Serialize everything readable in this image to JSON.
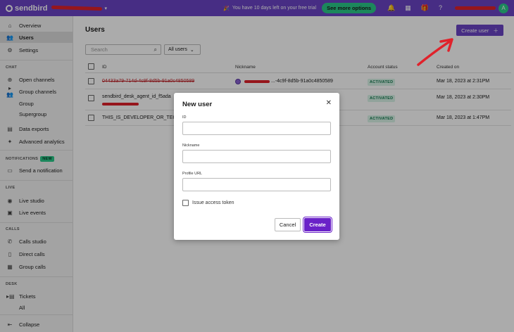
{
  "topbar": {
    "brand": "sendbird",
    "trial_text": "You have 10 days left on your free trial",
    "see_more": "See more options",
    "avatar_initial": "A",
    "icons": [
      "party-icon",
      "bell-icon",
      "grid-icon",
      "gift-icon",
      "help-icon"
    ]
  },
  "sidebar": {
    "items": [
      {
        "label": "Overview",
        "icon": "home-icon"
      },
      {
        "label": "Users",
        "icon": "users-icon"
      },
      {
        "label": "Settings",
        "icon": "gear-icon"
      }
    ],
    "chat_section": "CHAT",
    "chat_items": [
      {
        "label": "Open channels",
        "icon": "open-channels-icon"
      },
      {
        "label": "Group channels",
        "icon": "group-channels-icon"
      }
    ],
    "group_sub": [
      "Group",
      "Supergroup"
    ],
    "data_items": [
      {
        "label": "Data exports",
        "icon": "data-exports-icon"
      },
      {
        "label": "Advanced analytics",
        "icon": "analytics-icon"
      }
    ],
    "notifications_section": "NOTIFICATIONS",
    "new_badge": "NEW",
    "notification_item": "Send a notification",
    "live_section": "LIVE",
    "live_items": [
      "Live studio",
      "Live events"
    ],
    "calls_section": "CALLS",
    "calls_items": [
      "Calls studio",
      "Direct calls",
      "Group calls"
    ],
    "desk_section": "DESK",
    "desk_item": "Tickets",
    "desk_sub": "All",
    "collapse": "Collapse"
  },
  "main": {
    "title": "Users",
    "create_user": "Create user",
    "search_placeholder": "Search",
    "filter_label": "All users",
    "columns": [
      "ID",
      "Nickname",
      "Account status",
      "Created on"
    ],
    "rows": [
      {
        "id": "04433a79-714d-4c9f-8d5b-91a0c4850589",
        "nickname": "...-4c9f-8d5b-91a0c4850589",
        "status": "ACTIVATED",
        "created": "Mar 18, 2023 at 2:31PM"
      },
      {
        "id": "sendbird_desk_agent_id_f5ada",
        "nickname": "",
        "status": "ACTIVATED",
        "created": "Mar 18, 2023 at 2:30PM"
      },
      {
        "id": "THIS_IS_DEVELOPER_OR_TECH",
        "nickname": "",
        "status": "ACTIVATED",
        "created": "Mar 18, 2023 at 1:47PM"
      }
    ]
  },
  "modal": {
    "title": "New user",
    "id_label": "ID",
    "nickname_label": "Nickname",
    "profile_url_label": "Profile URL",
    "issue_token": "Issue access token",
    "cancel": "Cancel",
    "create": "Create"
  },
  "colors": {
    "brand": "#6a44c5",
    "accent_green": "#2bc98a",
    "annotation_red": "#e0222b"
  }
}
